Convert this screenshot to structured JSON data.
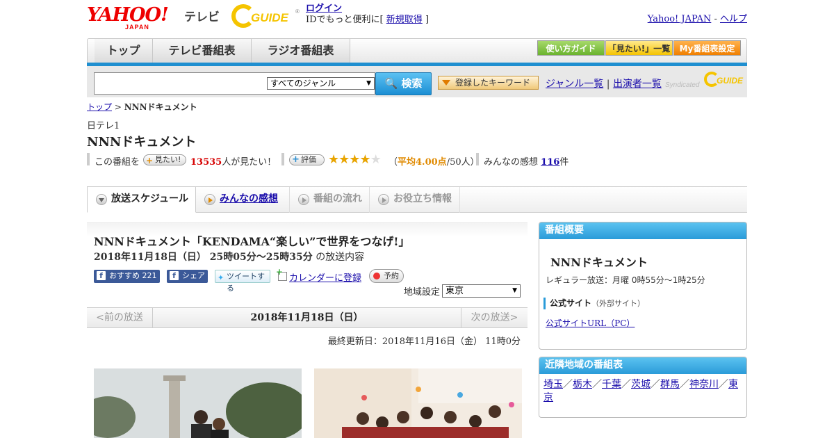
{
  "header": {
    "logo_text": "YAHOO!",
    "logo_sub": "JAPAN",
    "service": "テレビ",
    "gguide": "GUIDE",
    "login": "ログイン",
    "login_note": "IDでもっと便利に[",
    "signup": "新規取得",
    "login_note_end": "]",
    "yahoo_japan": "Yahoo! JAPAN",
    "sep": " - ",
    "help": "ヘルプ"
  },
  "nav": {
    "tabs": [
      "トップ",
      "テレビ番組表",
      "ラジオ番組表"
    ],
    "buttons": [
      "使い方ガイド",
      "「見たい!」一覧",
      "My番組表設定"
    ]
  },
  "search": {
    "genre": "すべてのジャンル",
    "button": "検索",
    "keyword_button": "登録したキーワード",
    "genre_list": "ジャンル一覧",
    "divider": "|",
    "cast_list": "出演者一覧",
    "syndicated": "Syndicated",
    "syndicated_logo": "GUIDE"
  },
  "breadcrumb": {
    "home": "トップ",
    "sep": " > ",
    "current": "NNNドキュメント"
  },
  "program": {
    "channel": "日テレ1",
    "title": "NNNドキュメント",
    "want_prefix": "この番組を",
    "want_button": "見たい!",
    "want_count": "13535",
    "want_suffix": "人が見たい！",
    "rate_button": "評価",
    "rating": 4,
    "rating_open": "（",
    "rating_avg": "平均4.00点",
    "rating_people": "/50人）",
    "comments_prefix": "みんなの感想",
    "comments_count": "116",
    "comments_suffix": "件"
  },
  "tabs": [
    {
      "label": "放送スケジュール"
    },
    {
      "label": "みんなの感想"
    },
    {
      "label": "番組の流れ"
    },
    {
      "label": "お役立ち情報"
    }
  ],
  "episode": {
    "title": "NNNドキュメント「KENDAMA“楽しい”で世界をつなげ!」",
    "date": "2018年11月18日（日） 25時05分～25時35分",
    "date_suffix": "の放送内容",
    "fb_recommend": "おすすめ",
    "fb_recommend_count": "221",
    "fb_share": "シェア",
    "tweet": "ツイートする",
    "calendar": "カレンダーに登録",
    "reserve": "予約",
    "region_label": "地域設定",
    "region_value": "東京",
    "prev": "<前の放送",
    "current_date": "2018年11月18日（日）",
    "next": "次の放送>",
    "updated": "最終更新日：2018年11月16日（金） 11時0分"
  },
  "sidebar": {
    "overview_head": "番組概要",
    "overview_title": "NNNドキュメント",
    "regular": "レギュラー放送：月曜 0時55分～1時25分",
    "official": "公式サイト",
    "official_ext": "（外部サイト）",
    "official_url": "公式サイトURL（PC）",
    "nearby_head": "近隣地域の番組表",
    "regions": [
      "埼玉",
      "栃木",
      "千葉",
      "茨城",
      "群馬",
      "神奈川",
      "東京"
    ],
    "region_sep": "／"
  },
  "colors": {
    "accent_blue": "#2a9bd9",
    "yahoo_red": "#ee0000",
    "gguide_yellow": "#f5c400",
    "star": "#e8a400",
    "link": "#1a0dab"
  }
}
